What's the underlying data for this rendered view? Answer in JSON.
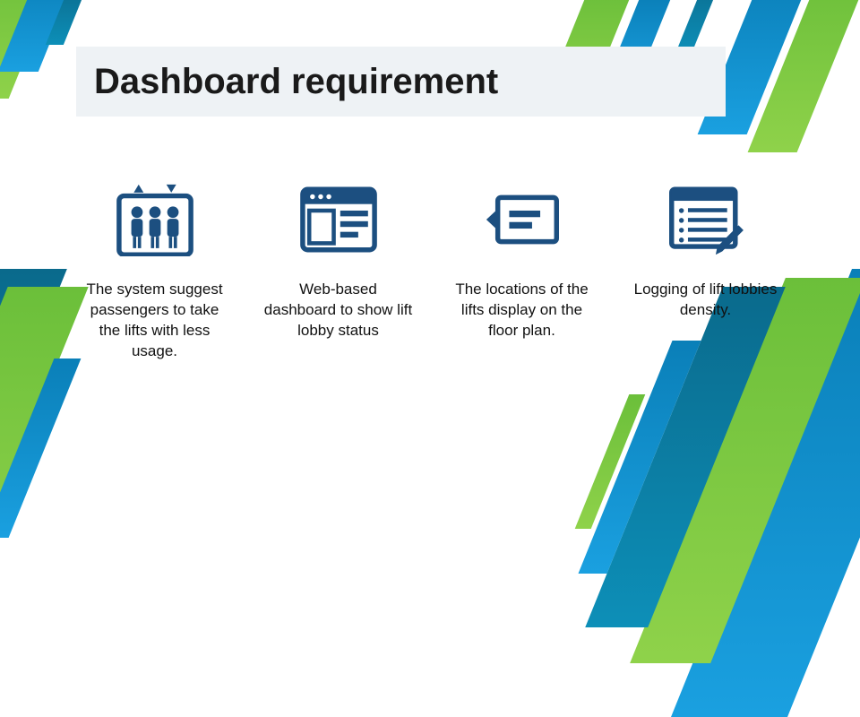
{
  "title": "Dashboard requirement",
  "features": [
    {
      "icon": "people-elevator-icon",
      "text": "The system suggest passengers to take the lifts with less usage."
    },
    {
      "icon": "web-dashboard-icon",
      "text": "Web-based dashboard to show lift lobby status"
    },
    {
      "icon": "floorplan-icon",
      "text": "The locations of the lifts display on the floor plan."
    },
    {
      "icon": "log-list-icon",
      "text": "Logging of lift lobbies density."
    }
  ],
  "palette": {
    "icon": "#1c4f80",
    "title_bg": "#eef2f5",
    "accent_blue": "#1aa0e0",
    "accent_green": "#8fd24a",
    "accent_teal": "#0d8fb8"
  }
}
